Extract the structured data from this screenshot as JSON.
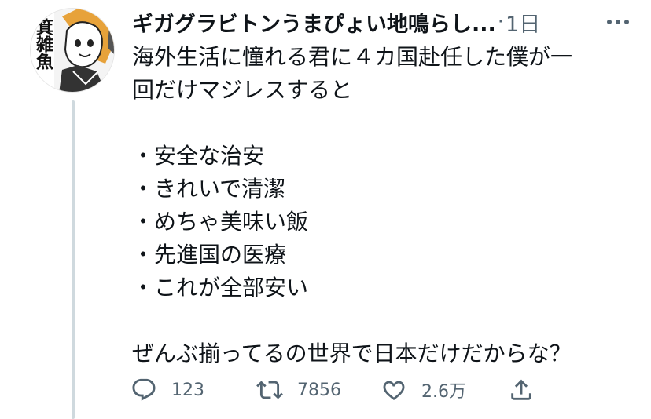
{
  "tweet": {
    "display_name": "ギガグラビトンうまぴょい地鳴らし...",
    "separator": "·",
    "timestamp": "1日",
    "lines": [
      "海外生活に憧れる君に４カ国赴任した僕が一",
      "回だけマジレスすると",
      "",
      "・安全な治安",
      "・きれいで清潔",
      "・めちゃ美味い飯",
      "・先進国の医療",
      "・これが全部安い",
      "",
      "ぜんぶ揃ってるの世界で日本だけだからな？"
    ],
    "avatar_text": "箕雑魚"
  },
  "actions": {
    "reply": {
      "icon": "reply-icon",
      "count": "123"
    },
    "retweet": {
      "icon": "retweet-icon",
      "count": "7856"
    },
    "like": {
      "icon": "heart-icon",
      "count": "2.6万"
    },
    "share": {
      "icon": "share-icon"
    }
  },
  "colors": {
    "text": "#0f1419",
    "secondary": "#536471",
    "thread_line": "#cfd9de"
  }
}
